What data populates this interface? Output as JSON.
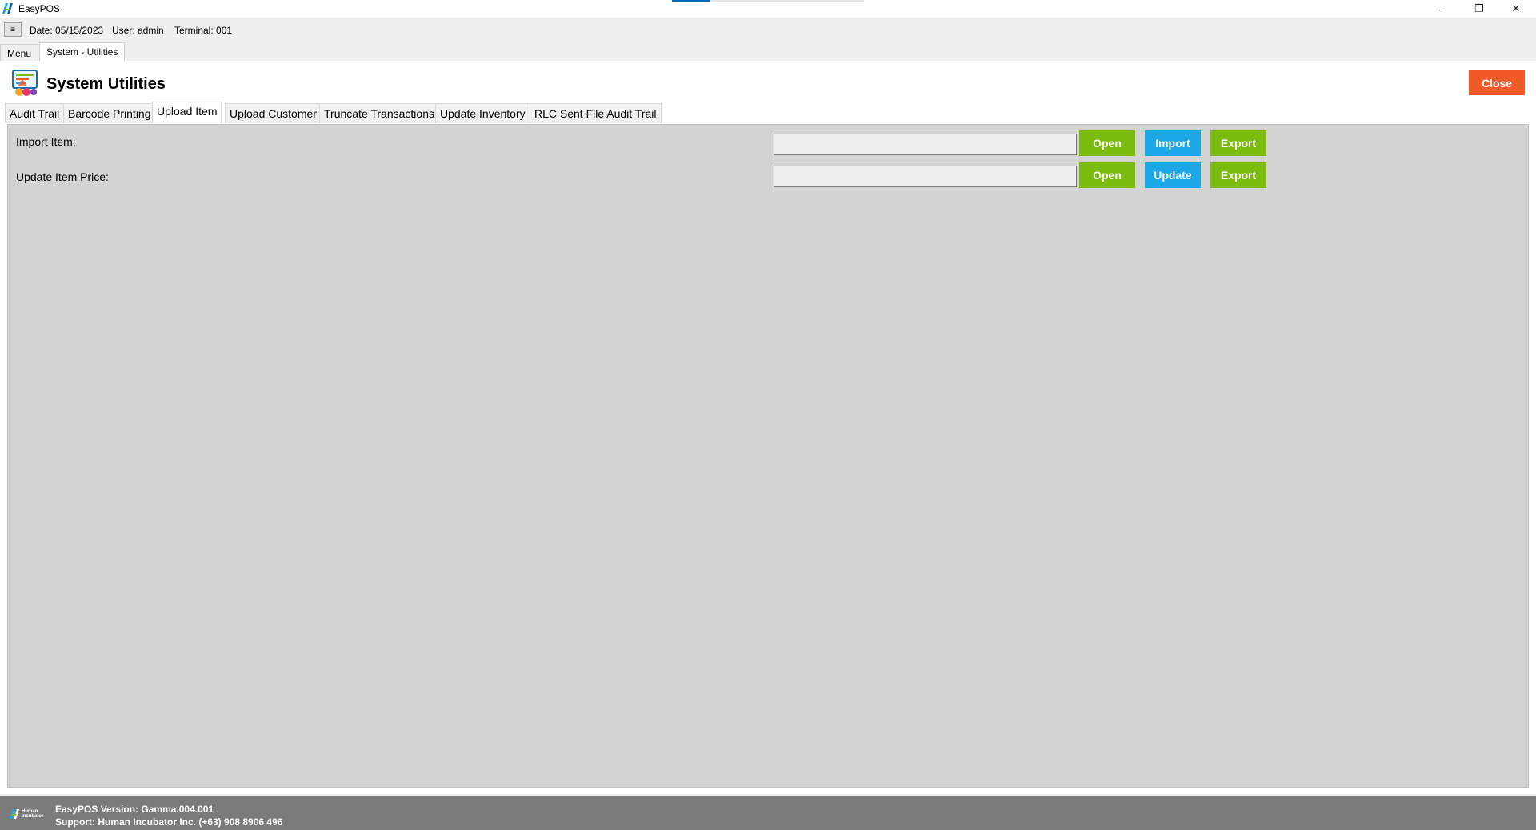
{
  "window": {
    "title": "EasyPOS",
    "progress": 0.2,
    "controls": {
      "minimize": "–",
      "maximize": "❐",
      "close": "✕"
    }
  },
  "infobar": {
    "menu_toggle": "≡",
    "date": "Date: 05/15/2023",
    "user": "User: admin",
    "terminal": "Terminal: 001"
  },
  "doc_tabs": [
    "Menu",
    "System - Utilities"
  ],
  "header": {
    "icon": "system-utilities-icon",
    "title": "System Utilities",
    "close_label": "Close"
  },
  "tabs": [
    {
      "label": "Audit Trail",
      "active": false
    },
    {
      "label": "Barcode Printing",
      "active": false
    },
    {
      "label": "Upload Item",
      "active": true
    },
    {
      "label": "Upload Customer",
      "active": false
    },
    {
      "label": "Truncate Transactions",
      "active": false
    },
    {
      "label": "Update Inventory",
      "active": false
    },
    {
      "label": "RLC Sent File Audit Trail",
      "active": false
    }
  ],
  "upload_item": {
    "import_row": {
      "label": "Import Item:",
      "value": "",
      "open_label": "Open",
      "action_label": "Import",
      "export_label": "Export"
    },
    "price_row": {
      "label": "Update Item Price:",
      "value": "",
      "open_label": "Open",
      "action_label": "Update",
      "export_label": "Export"
    }
  },
  "colors": {
    "green_button": "#7cbc0e",
    "blue_button": "#1ba7e6",
    "close_button": "#f05a28",
    "footer": "#7b7b7b",
    "panel": "#d3d3d3"
  },
  "footer": {
    "logo_text": "Human Incubator",
    "version": "EasyPOS Version: Gamma.004.001",
    "support": "Support: Human Incubator Inc. (+63) 908 8906 496"
  }
}
